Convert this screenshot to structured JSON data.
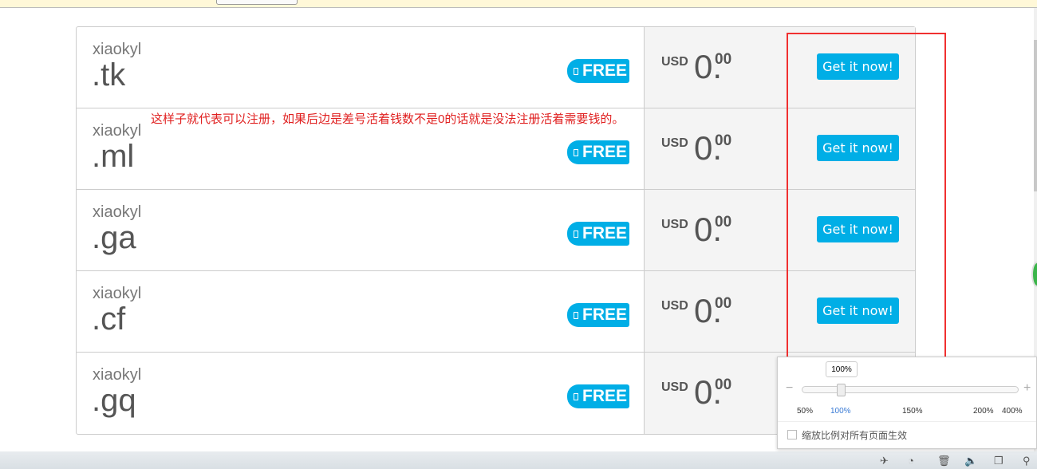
{
  "rows": [
    {
      "owner": "xiaokyl",
      "tld": ".tk",
      "badge": "FREE",
      "currency": "USD",
      "amount": "0.",
      "cents": "00",
      "button": "Get it now!"
    },
    {
      "owner": "xiaokyl",
      "tld": ".ml",
      "badge": "FREE",
      "currency": "USD",
      "amount": "0.",
      "cents": "00",
      "button": "Get it now!"
    },
    {
      "owner": "xiaokyl",
      "tld": ".ga",
      "badge": "FREE",
      "currency": "USD",
      "amount": "0.",
      "cents": "00",
      "button": "Get it now!"
    },
    {
      "owner": "xiaokyl",
      "tld": ".cf",
      "badge": "FREE",
      "currency": "USD",
      "amount": "0.",
      "cents": "00",
      "button": "Get it now!"
    },
    {
      "owner": "xiaokyl",
      "tld": ".gq",
      "badge": "FREE",
      "currency": "USD",
      "amount": "0.",
      "cents": "00",
      "button": ""
    }
  ],
  "annotation": "这样子就代表可以注册，如果后边是差号活着钱数不是0的话就是没法注册活着需要钱的。",
  "zoom": {
    "current": "100%",
    "value_percent": 100,
    "ticks": [
      "50%",
      "100%",
      "150%",
      "200%",
      "400%"
    ],
    "minus": "−",
    "plus": "+",
    "apply_all": "缩放比例对所有页面生效"
  },
  "statusbar": {
    "icons": [
      "rocket-icon",
      "speed-icon",
      "trash-icon",
      "speaker-icon",
      "window-icon",
      "zoom-icon"
    ]
  },
  "colors": {
    "accent": "#00aee6",
    "annotation": "#e02020"
  }
}
